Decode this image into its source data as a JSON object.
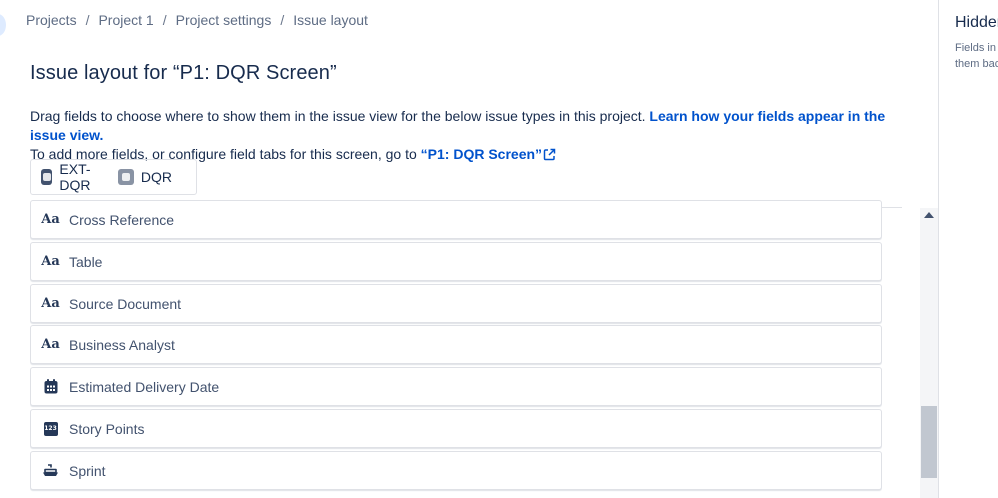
{
  "breadcrumb": {
    "items": [
      "Projects",
      "Project 1",
      "Project settings",
      "Issue layout"
    ],
    "separator": "/"
  },
  "page": {
    "title": "Issue layout for “P1: DQR Screen”"
  },
  "description": {
    "line1_text": "Drag fields to choose where to show them in the issue view for the below issue types in this project. ",
    "line1_link": "Learn how your fields appear in the issue view.",
    "line2_text": "To add more fields, or configure field tabs for this screen, go to ",
    "line2_link": "“P1: DQR Screen”"
  },
  "issue_types": [
    {
      "label": "EXT-DQR",
      "icon": "issue-type-ext-dqr-icon"
    },
    {
      "label": "DQR",
      "icon": "issue-type-dqr-icon"
    }
  ],
  "fields": [
    {
      "label": "Cross Reference",
      "icon": "text-field-icon"
    },
    {
      "label": "Table",
      "icon": "text-field-icon"
    },
    {
      "label": "Source Document",
      "icon": "text-field-icon"
    },
    {
      "label": "Business Analyst",
      "icon": "text-field-icon"
    },
    {
      "label": "Estimated Delivery Date",
      "icon": "calendar-icon"
    },
    {
      "label": "Story Points",
      "icon": "number-field-icon"
    },
    {
      "label": "Sprint",
      "icon": "sprint-boat-icon"
    }
  ],
  "field_icon_glyphs": {
    "text": "Aa",
    "number": "123"
  },
  "right_panel": {
    "title": "Hidden",
    "description": "Fields in this section are hidden, drag them back"
  },
  "colors": {
    "link": "#0052cc",
    "text": "#172b4d",
    "muted": "#5e6c84",
    "border": "#dfe1e6"
  }
}
